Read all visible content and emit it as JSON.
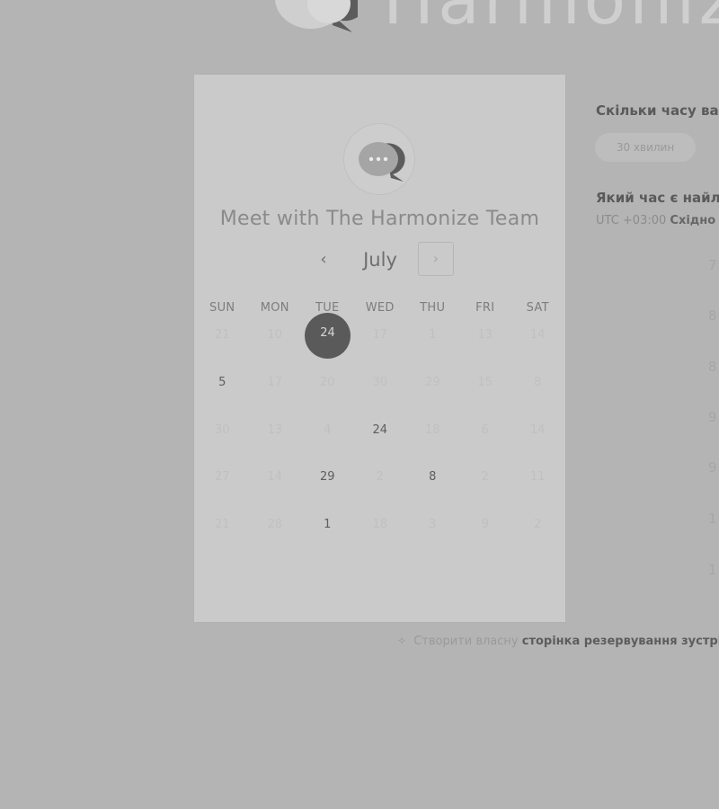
{
  "brand": {
    "name": "Harmonize"
  },
  "card": {
    "title": "Meet with The Harmonize Team",
    "month": "July",
    "weekdays": [
      "SUN",
      "MON",
      "TUE",
      "WED",
      "THU",
      "FRI",
      "SAT"
    ],
    "weeks": [
      [
        {
          "d": "21",
          "a": false
        },
        {
          "d": "10",
          "a": false
        },
        {
          "d": "24",
          "a": true,
          "sel": true
        },
        {
          "d": "17",
          "a": false
        },
        {
          "d": "1",
          "a": false
        },
        {
          "d": "13",
          "a": false
        },
        {
          "d": "14",
          "a": false
        }
      ],
      [
        {
          "d": "5",
          "a": true
        },
        {
          "d": "17",
          "a": false
        },
        {
          "d": "20",
          "a": false
        },
        {
          "d": "30",
          "a": false
        },
        {
          "d": "29",
          "a": false
        },
        {
          "d": "15",
          "a": false
        },
        {
          "d": "8",
          "a": false
        }
      ],
      [
        {
          "d": "30",
          "a": false
        },
        {
          "d": "13",
          "a": false
        },
        {
          "d": "4",
          "a": false
        },
        {
          "d": "24",
          "a": true
        },
        {
          "d": "18",
          "a": false
        },
        {
          "d": "6",
          "a": false
        },
        {
          "d": "14",
          "a": false
        }
      ],
      [
        {
          "d": "27",
          "a": false
        },
        {
          "d": "14",
          "a": false
        },
        {
          "d": "29",
          "a": true
        },
        {
          "d": "2",
          "a": false
        },
        {
          "d": "8",
          "a": true
        },
        {
          "d": "2",
          "a": false
        },
        {
          "d": "11",
          "a": false
        }
      ],
      [
        {
          "d": "21",
          "a": false
        },
        {
          "d": "28",
          "a": false
        },
        {
          "d": "1",
          "a": true
        },
        {
          "d": "18",
          "a": false
        },
        {
          "d": "3",
          "a": false
        },
        {
          "d": "9",
          "a": false
        },
        {
          "d": "2",
          "a": false
        }
      ]
    ]
  },
  "side": {
    "duration_heading": "Скільки часу вам",
    "duration_option": "30 хвилин",
    "time_heading": "Який час є найлі",
    "tz_offset": "UTC +03:00",
    "tz_name": "Східно",
    "slots": [
      "7",
      "8",
      "8",
      "9",
      "9",
      "1",
      "1"
    ]
  },
  "footer": {
    "prefix": "Створити власну",
    "link": "сторінка резервування зустріч"
  },
  "icons": {
    "brand_logo": "chat-bubbles-icon",
    "card_logo": "chat-bubbles-icon",
    "prev": "chevron-left-icon",
    "next": "chevron-right-icon",
    "sparkle": "sparkle-icon"
  }
}
